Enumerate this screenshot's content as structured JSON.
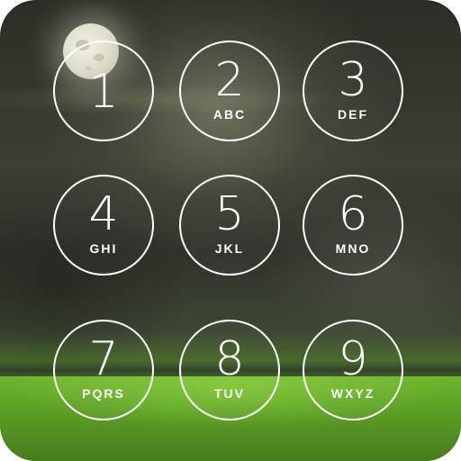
{
  "keypad": {
    "keys": [
      {
        "digit": "1",
        "letters": ""
      },
      {
        "digit": "2",
        "letters": "ABC"
      },
      {
        "digit": "3",
        "letters": "DEF"
      },
      {
        "digit": "4",
        "letters": "GHI"
      },
      {
        "digit": "5",
        "letters": "JKL"
      },
      {
        "digit": "6",
        "letters": "MNO"
      },
      {
        "digit": "7",
        "letters": "PQRS"
      },
      {
        "digit": "8",
        "letters": "TUV"
      },
      {
        "digit": "9",
        "letters": "WXYZ"
      }
    ]
  },
  "colors": {
    "key_ring": "#ffffff",
    "key_text": "#ffffff",
    "sky_dark": "#2a2e26",
    "grass": "#5c9f26"
  },
  "background": {
    "scene": "night sky with full moon over green grass field"
  }
}
